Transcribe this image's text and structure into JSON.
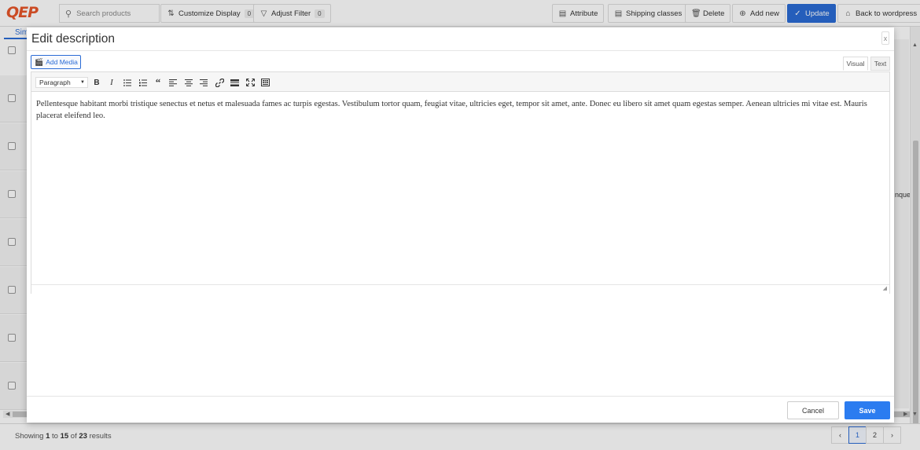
{
  "app": {
    "logo": "QEP",
    "search": {
      "placeholder": "Search products"
    },
    "toolbar": {
      "customize": {
        "label": "Customize Display",
        "count": "0"
      },
      "filter": {
        "label": "Adjust Filter",
        "count": "0"
      },
      "attribute": "Attribute",
      "shipping": "Shipping classes",
      "delete": "Delete",
      "add_new": "Add new",
      "update": "Update",
      "back": "Back to wordpress"
    },
    "tab_partial": "Sim",
    "right_partial": "nque",
    "footer": {
      "showing_prefix": "Showing ",
      "from": "1",
      "to_word": " to ",
      "to": "15",
      "of_word": " of ",
      "total": "23",
      "suffix": " results"
    },
    "pagination": {
      "prev": "‹",
      "pages": [
        "1",
        "2"
      ],
      "next": "›"
    },
    "colors": {
      "accent": "#2b6cd5",
      "logo": "#e8562a",
      "save": "#2b7cf0"
    }
  },
  "modal": {
    "title": "Edit description",
    "close": "x",
    "add_media": "Add Media",
    "tabs": {
      "visual": "Visual",
      "text": "Text"
    },
    "format": "Paragraph",
    "toolbar_icons": [
      "bold-icon",
      "italic-icon",
      "bullet-list-icon",
      "numbered-list-icon",
      "blockquote-icon",
      "align-left-icon",
      "align-center-icon",
      "align-right-icon",
      "link-icon",
      "read-more-icon",
      "fullscreen-icon",
      "toolbar-toggle-icon"
    ],
    "content": "Pellentesque habitant morbi tristique senectus et netus et malesuada fames ac turpis egestas. Vestibulum tortor quam, feugiat vitae, ultricies eget, tempor sit amet, ante. Donec eu libero sit amet quam egestas semper. Aenean ultricies mi vitae est. Mauris placerat eleifend leo.",
    "cancel": "Cancel",
    "save": "Save"
  }
}
